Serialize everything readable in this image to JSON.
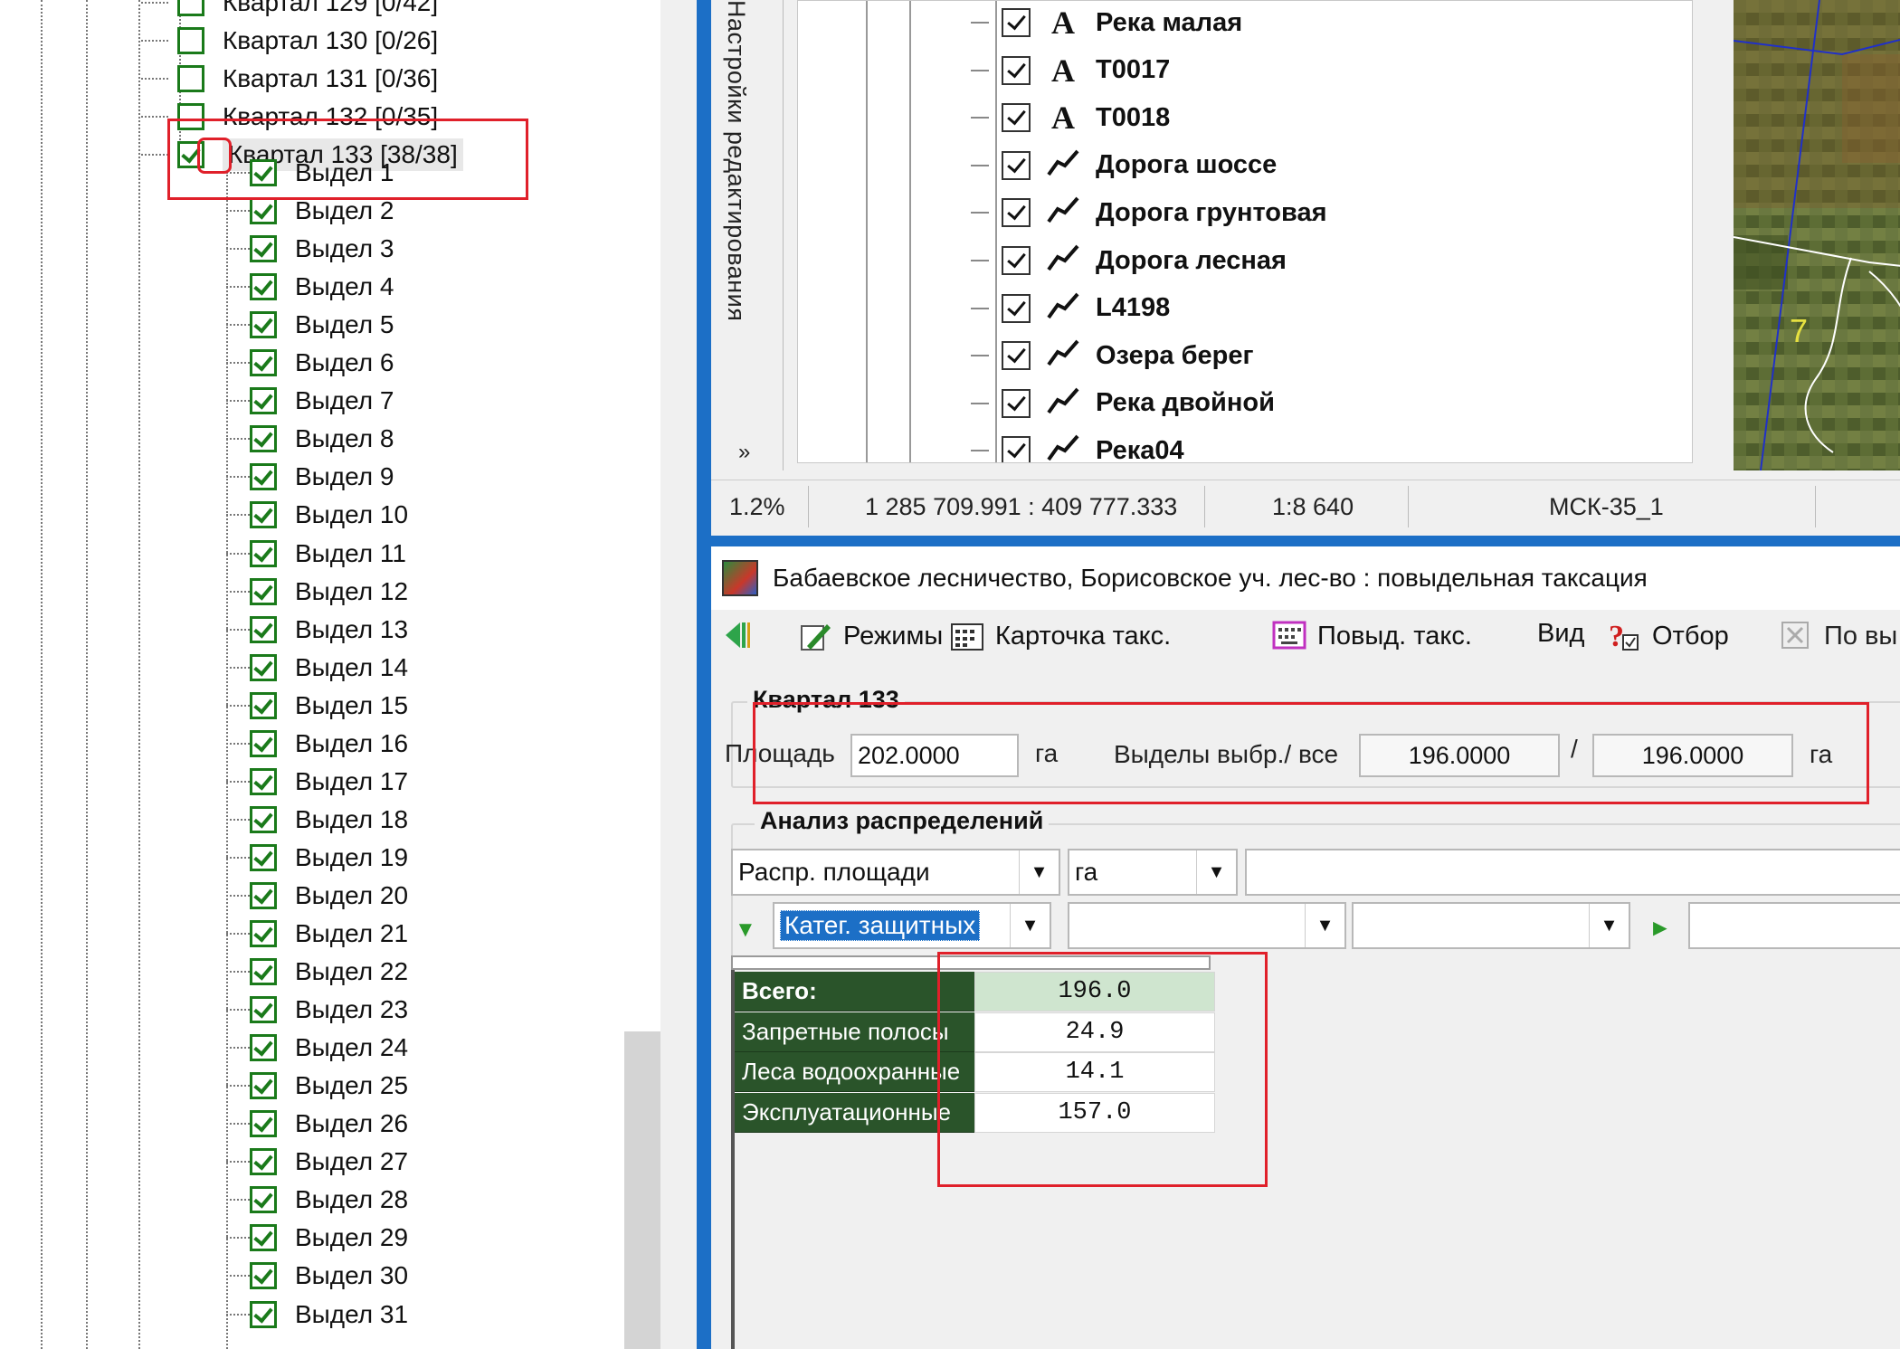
{
  "tree": {
    "quarters": [
      {
        "label": "Квартал 129 [0/42]",
        "checked": false
      },
      {
        "label": "Квартал 130 [0/26]",
        "checked": false
      },
      {
        "label": "Квартал 131 [0/36]",
        "checked": false
      },
      {
        "label": "Квартал 132 [0/35]",
        "checked": false
      },
      {
        "label": "Квартал 133 [38/38]",
        "checked": true
      }
    ],
    "sections": [
      "Выдел 1",
      "Выдел 2",
      "Выдел 3",
      "Выдел 4",
      "Выдел 5",
      "Выдел 6",
      "Выдел 7",
      "Выдел 8",
      "Выдел 9",
      "Выдел 10",
      "Выдел 11",
      "Выдел 12",
      "Выдел 13",
      "Выдел 14",
      "Выдел 15",
      "Выдел 16",
      "Выдел 17",
      "Выдел 18",
      "Выдел 19",
      "Выдел 20",
      "Выдел 21",
      "Выдел 22",
      "Выдел 23",
      "Выдел 24",
      "Выдел 25",
      "Выдел 26",
      "Выдел 27",
      "Выдел 28",
      "Выдел 29",
      "Выдел 30",
      "Выдел 31"
    ]
  },
  "side_tab": {
    "label": "Настройки редактирования"
  },
  "layers": [
    {
      "label": "Река малая",
      "icon": "text-layer-icon"
    },
    {
      "label": "T0017",
      "icon": "text-layer-icon"
    },
    {
      "label": "T0018",
      "icon": "text-layer-icon"
    },
    {
      "label": "Дорога шоссе",
      "icon": "line-layer-icon"
    },
    {
      "label": "Дорога грунтовая",
      "icon": "line-layer-icon"
    },
    {
      "label": "Дорога лесная",
      "icon": "line-layer-icon"
    },
    {
      "label": "L4198",
      "icon": "line-layer-icon"
    },
    {
      "label": "Озера берег",
      "icon": "line-layer-icon"
    },
    {
      "label": "Река двойной",
      "icon": "line-layer-icon"
    },
    {
      "label": "Река04",
      "icon": "line-layer-icon"
    }
  ],
  "map": {
    "label": "7"
  },
  "status": {
    "zoom": "1.2%",
    "coords": "1 285 709.991 : 409 777.333",
    "scale": "1:8 640",
    "crs": "МСК-35_1"
  },
  "panel": {
    "title": "Бабаевское лесничество, Борисовское уч. лес-во : повыдельная таксация",
    "toolbar": {
      "modes": "Режимы",
      "card": "Карточка такс.",
      "povyd": "Повыд. такс.",
      "view": "Вид",
      "filter": "Отбор",
      "more": "По вы"
    },
    "quarter_group": "Квартал 133",
    "area_label": "Площадь",
    "area_value": "202.0000",
    "unit": "га",
    "sections_label": "Выделы выбр./ все",
    "selected_area": "196.0000",
    "slash": "/",
    "total_area": "196.0000",
    "unit2": "га",
    "analysis_group": "Анализ распределений",
    "dist_select": "Распр. площади",
    "unit_select": "га",
    "category_select": "Катег. защитных",
    "table": {
      "rows": [
        {
          "name": "Всего:",
          "value": "196.0"
        },
        {
          "name": "Запретные полосы",
          "value": "24.9"
        },
        {
          "name": "Леса водоохранные",
          "value": "14.1"
        },
        {
          "name": "Эксплуатационные",
          "value": "157.0"
        }
      ]
    }
  },
  "colors": {
    "accent_blue": "#1c6fc6",
    "highlight_red": "#e0202a",
    "grid_header_green": "#2a542a",
    "checkbox_green": "#1a7a1a"
  }
}
